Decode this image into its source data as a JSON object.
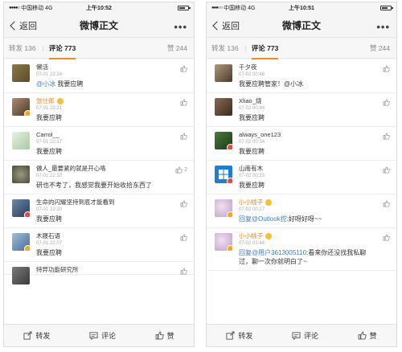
{
  "phones": [
    {
      "statusbar": {
        "carrier": "中国移动",
        "network": "4G",
        "time": "上午10:52"
      },
      "navbar": {
        "back": "返回",
        "title": "微博正文",
        "more": "•••"
      },
      "tabs": {
        "repost": "转发 136",
        "comment": "评论 773",
        "likes": "赞 244"
      },
      "comments": [
        {
          "name": "懒活",
          "time": "07-01 22:24",
          "mention": "@小冰",
          "text": " 我要应聘",
          "likes": "",
          "avatar_color": "#7a6a3a"
        },
        {
          "name": "张仕郎",
          "time": "07-01 22:21",
          "mention": "",
          "text": "我要应聘",
          "likes": "",
          "avatar_color": "#8a6e5a"
        },
        {
          "name": "Carrol__",
          "time": "07-01 22:17",
          "mention": "",
          "text": "我要应聘",
          "likes": "",
          "avatar_color": "#cfe3c8"
        },
        {
          "name": "做人_最要紧的就是开心咯",
          "time": "07-01 22:10",
          "mention": "",
          "text": "研也不考了，我感觉我要开始收拾东西了",
          "likes": "2",
          "avatar_color": "#6b6a5a"
        },
        {
          "name": "生命的闪耀坚持到底才能看到",
          "time": "07-01 22:10",
          "mention": "",
          "text": "我要应聘",
          "likes": "",
          "avatar_color": "#3a5a7a"
        },
        {
          "name": "木屐石语",
          "time": "07-01 22:07",
          "mention": "",
          "text": "我要应聘",
          "likes": "",
          "avatar_color": "#5a7aa0"
        },
        {
          "name": "特异功能研究所",
          "time": "",
          "mention": "",
          "text": "",
          "likes": "",
          "avatar_color": "#5a5a5a"
        }
      ],
      "bottombar": {
        "repost": "转发",
        "comment": "评论",
        "like": "赞"
      }
    },
    {
      "statusbar": {
        "carrier": "中国移动",
        "network": "4G",
        "time": "上午10:51"
      },
      "navbar": {
        "back": "返回",
        "title": "微博正文",
        "more": "•••"
      },
      "tabs": {
        "repost": "转发 136",
        "comment": "评论 773",
        "likes": "赞 244"
      },
      "comments": [
        {
          "name": "千夕夜",
          "time": "07-02 00:48",
          "mention": "",
          "text": "我要应聘管家！@小冰",
          "likes": "",
          "avatar_color": "#6a5a4a"
        },
        {
          "name": "Xliao_烧",
          "time": "07-02 00:44",
          "mention": "",
          "text": "我要应聘",
          "likes": "",
          "avatar_color": "#5a4a3a"
        },
        {
          "name": "always_one123",
          "time": "07-02 00:34",
          "mention": "",
          "text": "我要应聘",
          "likes": "",
          "avatar_color": "#2e5a2e"
        },
        {
          "name": "山南有木",
          "time": "07-02 00:33",
          "mention": "",
          "text": "我要应聘",
          "likes": "",
          "avatar_color": "#1e7fd0"
        },
        {
          "name": "小小桃子",
          "time": "07-02 00:27",
          "mention": "回复@Outlook控",
          "text": ":好呀好呀~~",
          "likes": "",
          "avatar_color": "#e0c8e0"
        },
        {
          "name": "小小桃子",
          "time": "07-02 01:44",
          "mention": "回复@用户3613005110",
          "text": ":看来你还没找我私聊过，聊一次你就明白了~",
          "likes": "",
          "avatar_color": "#e0c8e0"
        }
      ],
      "bottombar": {
        "repost": "转发",
        "comment": "评论",
        "like": "赞"
      }
    }
  ],
  "colors": {
    "accent": "#f08c1f",
    "mention": "#3d7cc9",
    "vip_name": "#e8862a"
  }
}
